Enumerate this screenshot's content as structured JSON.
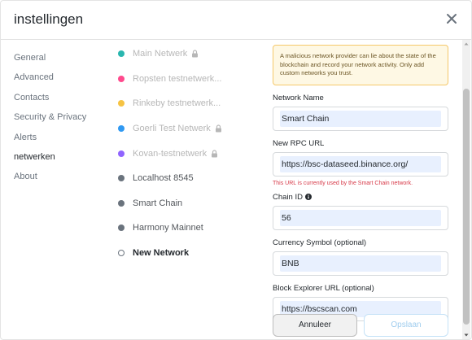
{
  "header": {
    "title": "instellingen"
  },
  "menu": {
    "items": [
      {
        "label": "General"
      },
      {
        "label": "Advanced"
      },
      {
        "label": "Contacts"
      },
      {
        "label": "Security & Privacy"
      },
      {
        "label": "Alerts"
      },
      {
        "label": "netwerken"
      },
      {
        "label": "About"
      }
    ]
  },
  "networks": {
    "items": [
      {
        "label": "Main Netwerk",
        "color": "#29b6af"
      },
      {
        "label": "Ropsten testnetwerk...",
        "color": "#ff4a8d"
      },
      {
        "label": "Rinkeby testnetwerk...",
        "color": "#f6c343"
      },
      {
        "label": "Goerli Test Netwerk",
        "color": "#3099f2"
      },
      {
        "label": "Kovan-testnetwerk",
        "color": "#9064ff"
      },
      {
        "label": "Localhost 8545",
        "color": "#6a737d"
      },
      {
        "label": "Smart Chain",
        "color": "#6a737d"
      },
      {
        "label": "Harmony Mainnet",
        "color": "#6a737d"
      },
      {
        "label": "New Network",
        "color": "#6a737d"
      }
    ]
  },
  "form": {
    "warning": "A malicious network provider can lie about the state of the blockchain and record your network activity. Only add custom networks you trust.",
    "network_name_label": "Network Name",
    "network_name_value": "Smart Chain",
    "rpc_url_label": "New RPC URL",
    "rpc_url_value": "https://bsc-dataseed.binance.org/",
    "rpc_error": "This URL is currently used by the Smart Chain network.",
    "chain_id_label": "Chain ID",
    "chain_id_value": "56",
    "currency_label": "Currency Symbol (optional)",
    "currency_value": "BNB",
    "explorer_label": "Block Explorer URL (optional)",
    "explorer_value": "https://bscscan.com"
  },
  "buttons": {
    "cancel": "Annuleer",
    "save": "Opslaan"
  }
}
